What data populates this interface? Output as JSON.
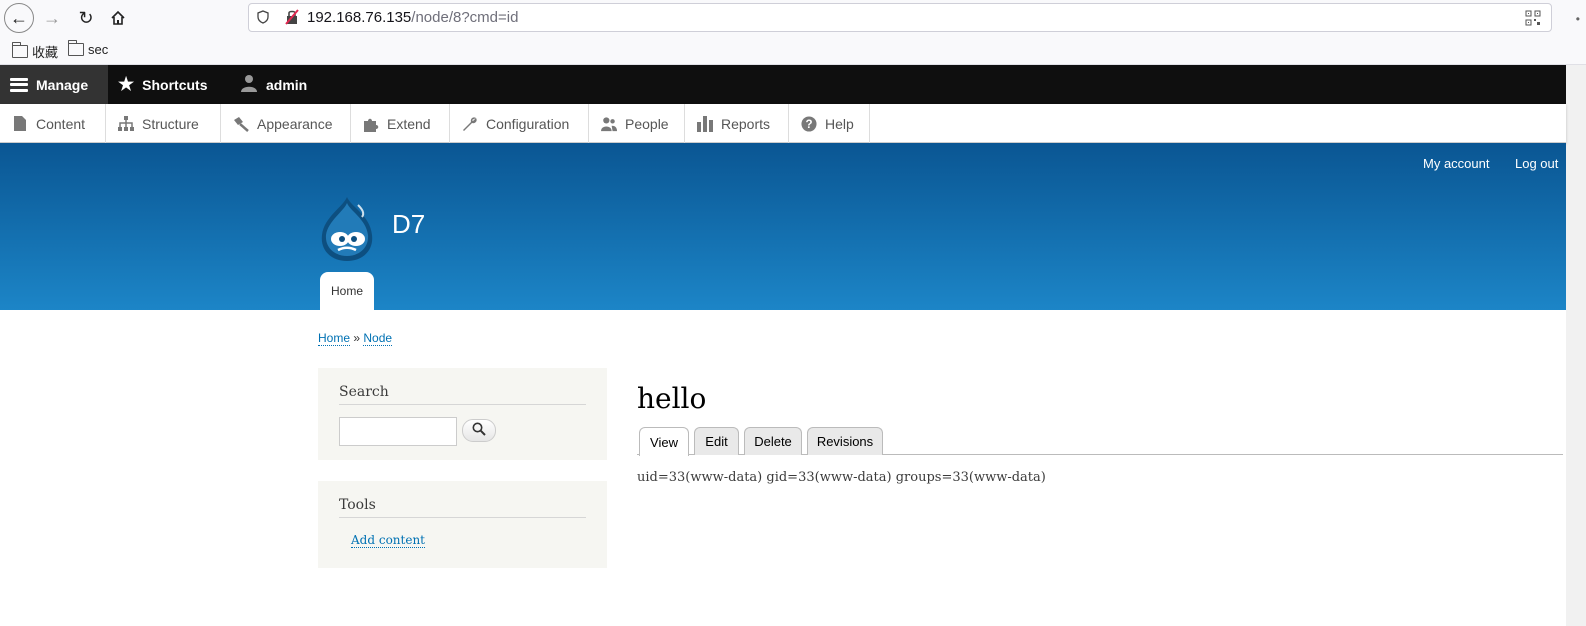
{
  "browser": {
    "url_host": "192.168.76.135",
    "url_path": "/node/8?cmd=id",
    "bookmarks": [
      "收藏",
      "sec"
    ]
  },
  "toolbar": {
    "manage": "Manage",
    "shortcuts": "Shortcuts",
    "user": "admin"
  },
  "tray": {
    "items": [
      "Content",
      "Structure",
      "Appearance",
      "Extend",
      "Configuration",
      "People",
      "Reports",
      "Help"
    ]
  },
  "header": {
    "my_account": "My account",
    "log_out": "Log out",
    "site_name": "D7",
    "main_menu_home": "Home"
  },
  "breadcrumb": {
    "home": "Home",
    "separator": "»",
    "node": "Node"
  },
  "sidebar": {
    "search_title": "Search",
    "tools_title": "Tools",
    "add_content": "Add content"
  },
  "node": {
    "title": "hello",
    "tabs": [
      "View",
      "Edit",
      "Delete",
      "Revisions"
    ],
    "body": "uid=33(www-data) gid=33(www-data) groups=33(www-data)"
  },
  "colors": {
    "header_top": "#0a5693",
    "header_bottom": "#1c85c7",
    "link": "#0071b3",
    "toolbar_bg": "#0f0f0f"
  }
}
